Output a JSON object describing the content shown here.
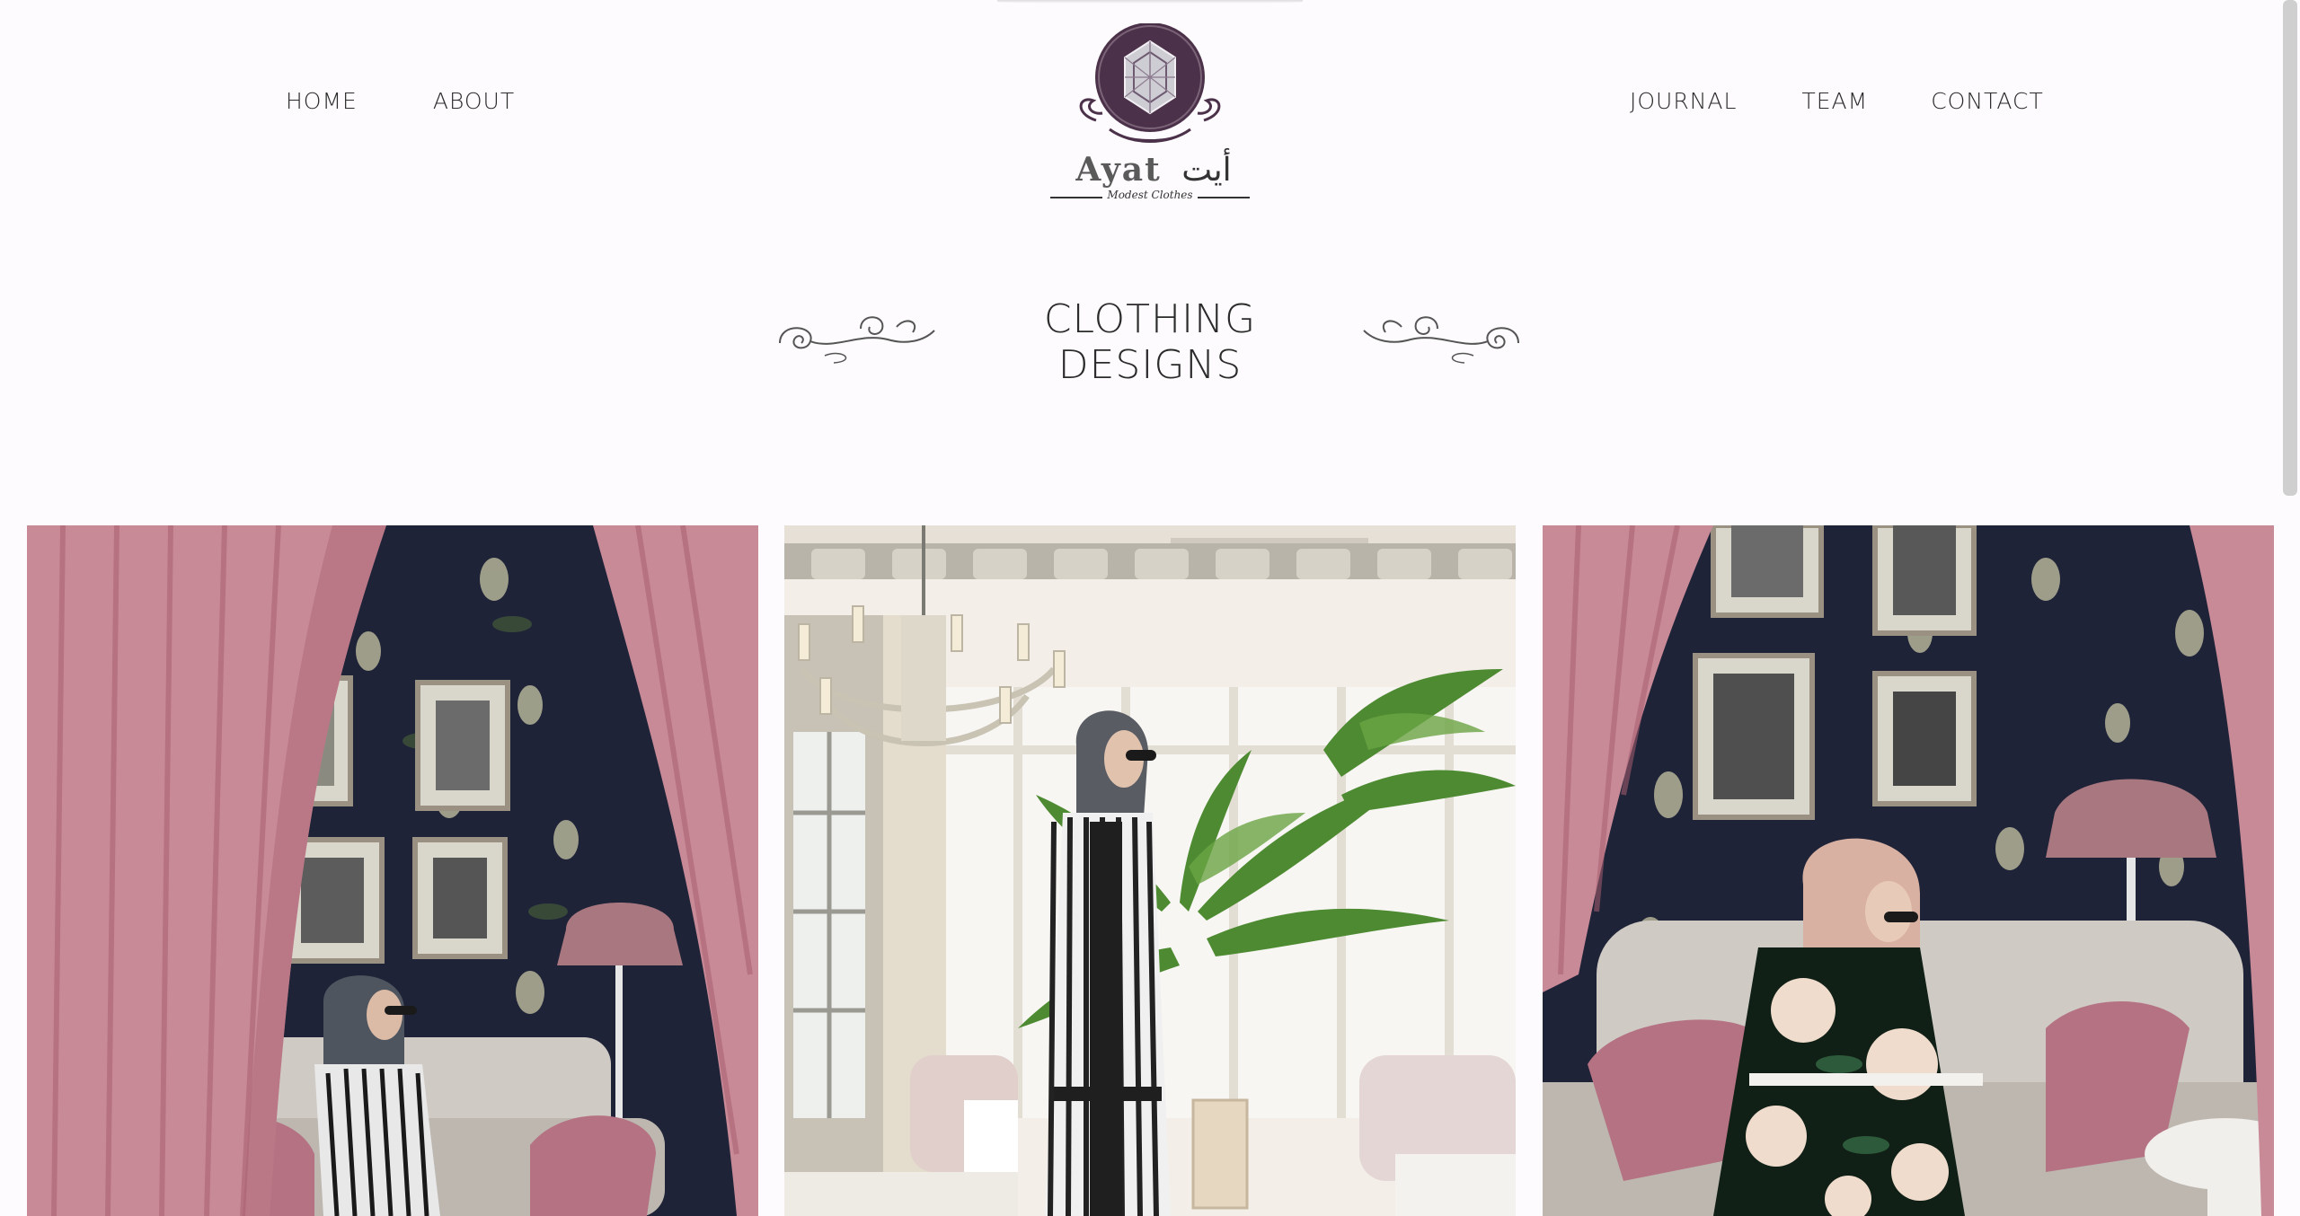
{
  "header": {
    "nav_left": [
      {
        "label": "HOME"
      },
      {
        "label": "ABOUT"
      }
    ],
    "nav_right": [
      {
        "label": "JOURNAL"
      },
      {
        "label": "TEAM"
      },
      {
        "label": "CONTACT"
      }
    ],
    "logo": {
      "brand_latin": "Ayat",
      "brand_arabic": "أيت",
      "tagline": "Modest Clothes",
      "brand_color": "#4b3149"
    }
  },
  "section": {
    "title": "CLOTHING DESIGNS"
  },
  "gallery": {
    "items": [
      {
        "scene": "velvet-curtains-floral-wallpaper",
        "accent": "#c98a98"
      },
      {
        "scene": "bright-window-chandelier-plants",
        "accent": "#e8e2d6"
      },
      {
        "scene": "floral-wallpaper-sofa-pink-hijab",
        "accent": "#c98a98"
      }
    ]
  },
  "colors": {
    "background": "#fdfbfd",
    "text": "#2b2b2b",
    "wallpaper": "#1f2338",
    "curtain": "#c98a98"
  }
}
